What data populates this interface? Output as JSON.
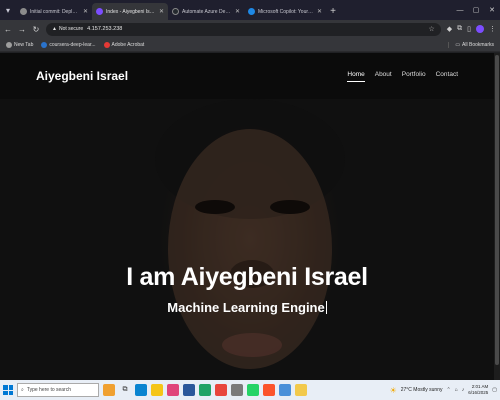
{
  "browser": {
    "tabs": [
      {
        "title": "Initial commit: Deploy static sit",
        "favicon_color": "#8b8b8b",
        "active": false
      },
      {
        "title": "Index - Aiyegbeni Israel - Portf",
        "favicon_color": "#7c4dff",
        "active": true
      },
      {
        "title": "Automate Azure Deployment u",
        "favicon_color": "#24292e",
        "active": false
      },
      {
        "title": "Microsoft Copilot: Your AI com",
        "favicon_color": "#1e88e5",
        "active": false
      }
    ],
    "security_label": "Not secure",
    "url": "4.157.253.238",
    "bookmarks": [
      {
        "label": "New Tab",
        "color": "#9e9e9e"
      },
      {
        "label": "coursera-deep-lear...",
        "color": "#2a73cc"
      },
      {
        "label": "Adobe Acrobat",
        "color": "#e53935"
      }
    ],
    "all_bookmarks_label": "All Bookmarks"
  },
  "site": {
    "brand": "Aiyegbeni Israel",
    "nav": [
      "Home",
      "About",
      "Portfolio",
      "Contact"
    ],
    "active_nav": "Home",
    "hero_title": "I am Aiyegbeni Israel",
    "hero_subtitle": "Machine Learning Engine"
  },
  "taskbar": {
    "search_placeholder": "Type here to search",
    "weather": "27°C  Mostly sunny",
    "time": "2:01 AM",
    "date": "6/16/2025"
  }
}
